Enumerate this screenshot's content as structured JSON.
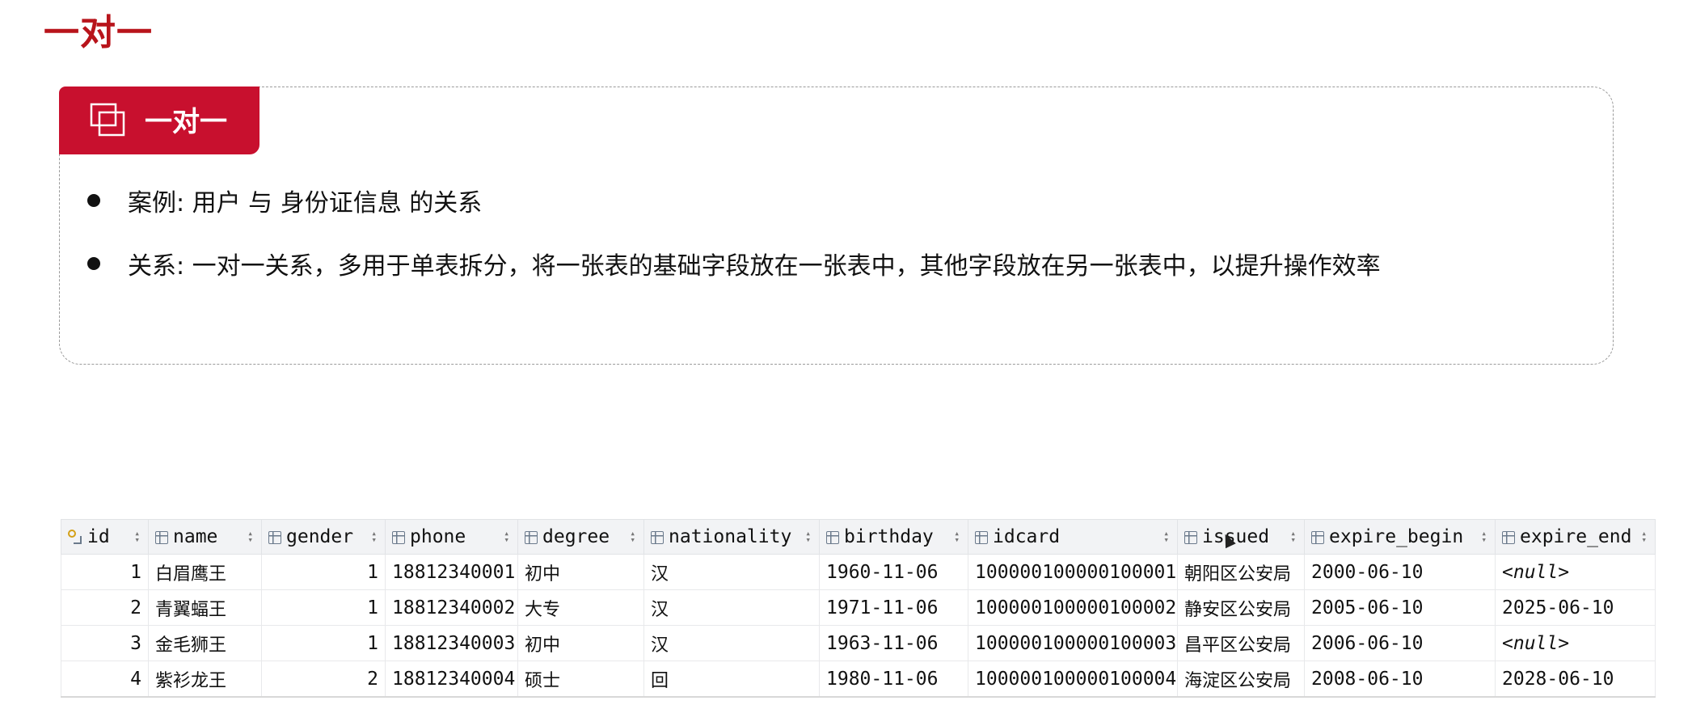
{
  "page": {
    "title": "一对一"
  },
  "card": {
    "tab_title": "一对一",
    "bullets": [
      "案例: 用户 与 身份证信息 的关系",
      "关系: 一对一关系，多用于单表拆分，将一张表的基础字段放在一张表中，其他字段放在另一张表中，以提升操作效率"
    ],
    "accent_color": "#c8102e"
  },
  "table": {
    "columns": [
      "id",
      "name",
      "gender",
      "phone",
      "degree",
      "nationality",
      "birthday",
      "idcard",
      "issued",
      "expire_begin",
      "expire_end"
    ],
    "rows": [
      [
        "1",
        "白眉鹰王",
        "1",
        "18812340001",
        "初中",
        "汉",
        "1960-11-06",
        "100000100000100001",
        "朝阳区公安局",
        "2000-06-10",
        "<null>"
      ],
      [
        "2",
        "青翼蝠王",
        "1",
        "18812340002",
        "大专",
        "汉",
        "1971-11-06",
        "100000100000100002",
        "静安区公安局",
        "2005-06-10",
        "2025-06-10"
      ],
      [
        "3",
        "金毛狮王",
        "1",
        "18812340003",
        "初中",
        "汉",
        "1963-11-06",
        "100000100000100003",
        "昌平区公安局",
        "2006-06-10",
        "<null>"
      ],
      [
        "4",
        "紫衫龙王",
        "2",
        "18812340004",
        "硕士",
        "回",
        "1980-11-06",
        "100000100000100004",
        "海淀区公安局",
        "2008-06-10",
        "2028-06-10"
      ]
    ]
  }
}
